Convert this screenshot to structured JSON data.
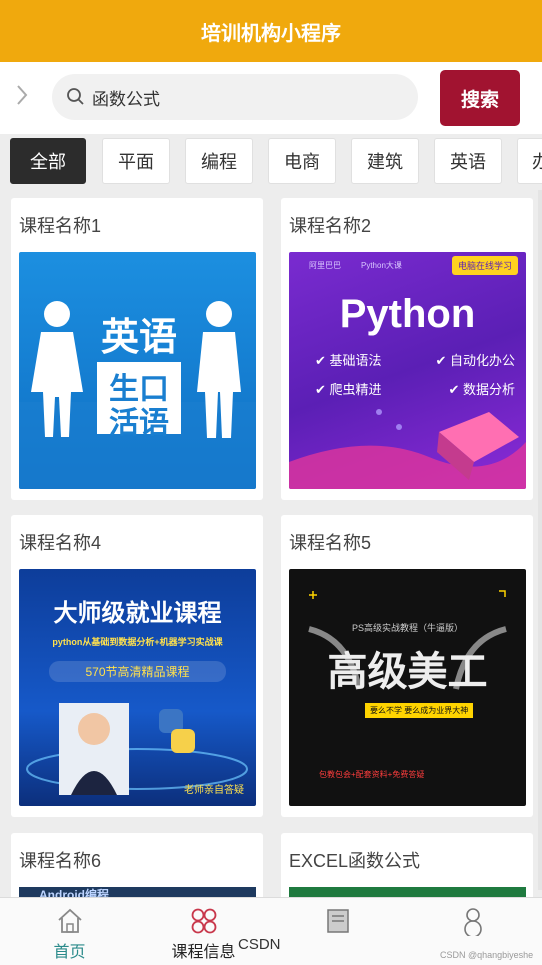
{
  "app": {
    "title": "培训机构小程序"
  },
  "search": {
    "placeholder": "函数公式",
    "value": "函数公式",
    "button_label": "搜索"
  },
  "categories": [
    "全部",
    "平面",
    "编程",
    "电商",
    "建筑",
    "英语",
    "办"
  ],
  "active_category": "全部",
  "courses": [
    {
      "title": "课程名称1",
      "image": {
        "word1": "英语",
        "word2a": "生口",
        "word2b": "活语"
      }
    },
    {
      "title": "课程名称2",
      "image": {
        "badge": "电脑在线学习",
        "small_left": "阿里巴巴",
        "small_right": "Python大课",
        "heading": "Python",
        "features": [
          "基础语法",
          "自动化办公",
          "爬虫精进",
          "数据分析"
        ]
      }
    },
    {
      "title": "课程名称4",
      "image": {
        "heading": "大师级就业课程",
        "line1": "python从基础到数据分析+机器学习实战课",
        "line2": "570节高清精品课程",
        "caption": "老师亲自答疑"
      }
    },
    {
      "title": "课程名称5",
      "image": {
        "small": "PS高级实战教程（牛逼版）",
        "heading": "高级美工",
        "sub": "要么不学 要么成为业界大神",
        "bottom": "包教包会+配套资料+免费答疑"
      }
    },
    {
      "title": "课程名称6",
      "image": {
        "heading": "Android编程"
      }
    },
    {
      "title": "EXCEL函数公式",
      "image": {}
    }
  ],
  "nav": [
    {
      "label": "首页",
      "icon": "home-icon",
      "color": "#2a8a8a"
    },
    {
      "label": "课程信息",
      "icon": "grid-flower-icon",
      "color": "#222222"
    },
    {
      "label": "",
      "icon": "album-icon",
      "color": "#333333"
    },
    {
      "label": "",
      "icon": "user-icon",
      "color": "#333333"
    }
  ],
  "watermarks": {
    "main": "CSDN",
    "corner": "CSDN @qhangbiyeshe"
  },
  "colors": {
    "header": "#f0a90d",
    "search_button": "#a11330",
    "active_tab": "#2c2c2c",
    "nav_active": "#2a8a8a"
  }
}
